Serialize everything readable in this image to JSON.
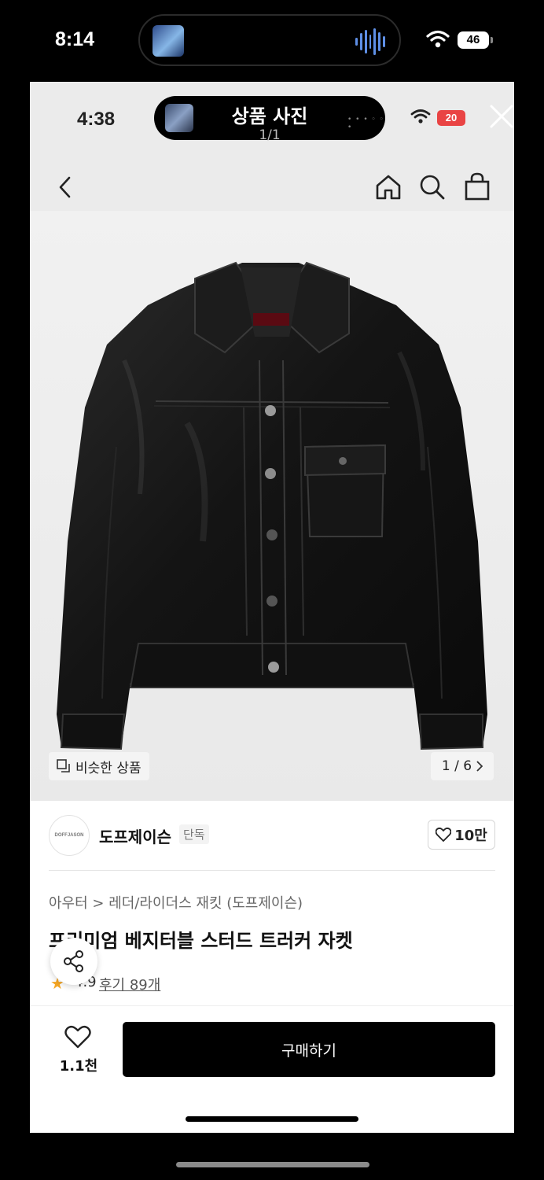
{
  "outer_status": {
    "time": "8:14",
    "battery": "46"
  },
  "inner_status": {
    "time": "4:38",
    "battery": "20"
  },
  "media_pill": {
    "title": "상품 사진",
    "counter": "1/1"
  },
  "product": {
    "similar_label": "비슷한 상품",
    "image_counter": "1 / 6",
    "brand_logo_text": "DOFFJASON",
    "brand_name": "도프제이슨",
    "brand_tag": "단독",
    "brand_likes": "10만",
    "breadcrumb_category": "아우터",
    "breadcrumb_sub": "레더/라이더스 재킷 (도프제이슨)",
    "title": "프리미엄 베지터블 스터드 트러커 자켓",
    "rating": "4.9",
    "reviews": "후기 89개"
  },
  "bottom_bar": {
    "wish_count": "1.1천",
    "buy_label": "구매하기"
  },
  "colors": {
    "accent": "#000000",
    "star": "#f5a623",
    "battery_low": "#e94444"
  },
  "icons": [
    "back-arrow-icon",
    "home-icon",
    "search-icon",
    "shopping-bag-icon",
    "close-icon",
    "heart-icon",
    "share-icon",
    "copy-icon",
    "chevron-right-icon",
    "star-icon",
    "wifi-icon"
  ]
}
